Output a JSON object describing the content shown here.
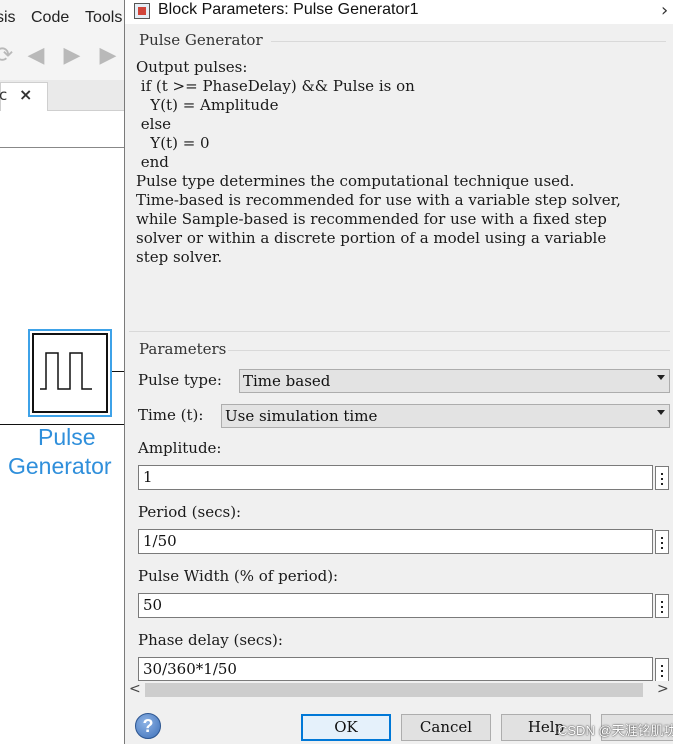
{
  "app": {
    "menu": [
      "sis",
      "Code",
      "Tools"
    ],
    "tab": {
      "label": "c",
      "close": "×"
    },
    "block": {
      "name_line1": "Pulse",
      "name_line2": "Generator"
    }
  },
  "dialog": {
    "title": "Block Parameters: Pulse Generator1",
    "description": {
      "group_title": "Pulse Generator",
      "lines": [
        "Output pulses:",
        "",
        " if (t >= PhaseDelay) && Pulse is on",
        "   Y(t) = Amplitude",
        " else",
        "   Y(t) = 0",
        " end",
        "",
        "Pulse type determines the computational technique used.",
        "",
        "Time-based is recommended for use with a variable step solver,",
        "while Sample-based is recommended for use with a fixed step",
        "solver or within a discrete portion of a model using a variable",
        "step solver."
      ]
    },
    "parameters": {
      "group_title": "Parameters",
      "pulse_type": {
        "label": "Pulse type:",
        "value": "Time based"
      },
      "time": {
        "label": "Time (t):",
        "value": "Use simulation time"
      },
      "amplitude": {
        "label": "Amplitude:",
        "value": "1"
      },
      "period": {
        "label": "Period (secs):",
        "value": "1/50"
      },
      "pulse_width": {
        "label": "Pulse Width (% of period):",
        "value": "50"
      },
      "phase_delay": {
        "label": "Phase delay (secs):",
        "value": "30/360*1/50"
      }
    },
    "buttons": {
      "ok": "OK",
      "cancel": "Cancel",
      "help": "Help"
    },
    "scroll": {
      "left": "<",
      "right": ">"
    }
  },
  "watermark": "CSDN @天涯铭肌功"
}
